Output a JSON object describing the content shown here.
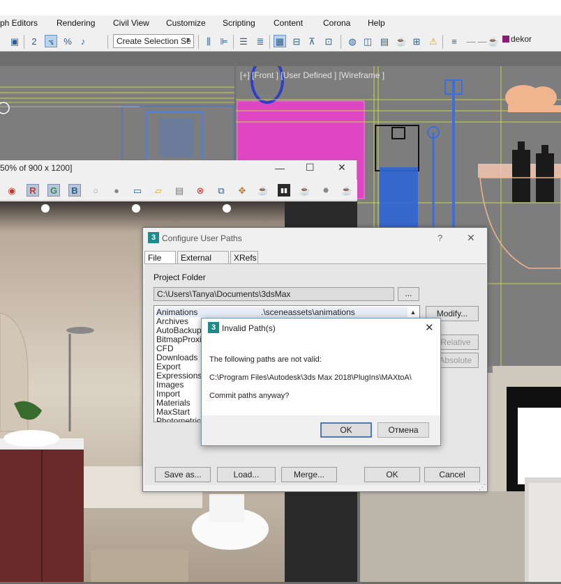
{
  "menubar": {
    "items": [
      "ph Editors",
      "Rendering",
      "Civil View",
      "Customize",
      "Scripting",
      "Content",
      "Corona",
      "Help"
    ]
  },
  "toolbar": {
    "selection_set": "Create Selection Se",
    "layer_name": "dekor"
  },
  "viewport_front": {
    "label": "[+] [Front ] [User Defined ] [Wireframe ]"
  },
  "frame_window": {
    "title": "50% of 900 x 1200]"
  },
  "config_dialog": {
    "title": "Configure User Paths",
    "help": "?",
    "close": "✕",
    "tabs": [
      "File I/O",
      "External Files",
      "XRefs"
    ],
    "project_folder_label": "Project Folder",
    "project_folder_value": "C:\\Users\\Tanya\\Documents\\3dsMax",
    "browse_label": "...",
    "paths": [
      {
        "name": "Animations",
        "value": ".\\sceneassets\\animations"
      },
      {
        "name": "Archives",
        "value": ""
      },
      {
        "name": "AutoBackup",
        "value": ""
      },
      {
        "name": "BitmapProxies",
        "value": ""
      },
      {
        "name": "CFD",
        "value": ""
      },
      {
        "name": "Downloads",
        "value": ""
      },
      {
        "name": "Export",
        "value": ""
      },
      {
        "name": "Expressions",
        "value": ""
      },
      {
        "name": "Images",
        "value": ""
      },
      {
        "name": "Import",
        "value": ""
      },
      {
        "name": "Materials",
        "value": ""
      },
      {
        "name": "MaxStart",
        "value": ""
      },
      {
        "name": "Photometric",
        "value": ""
      }
    ],
    "modify_label": "Modify...",
    "make_relative_label": "e Relative",
    "make_absolute_label": "e Absolute",
    "save_as_label": "Save as...",
    "load_label": "Load...",
    "merge_label": "Merge...",
    "ok_label": "OK",
    "cancel_label": "Cancel"
  },
  "invalid_dialog": {
    "title": "Invalid Path(s)",
    "close": "✕",
    "message": "The following paths are not valid:",
    "path": "C:\\Program Files\\Autodesk\\3ds Max 2018\\PlugIns\\MAXtoA\\",
    "question": "Commit paths anyway?",
    "ok_label": "OK",
    "cancel_label": "Отмена"
  },
  "colors": {
    "accent": "#4e7ab3",
    "app_icon": "#1f8a8a",
    "wireframe_pink": "#ee3ccd",
    "wireframe_blue": "#3a6fe0",
    "wireframe_yellow": "#c9d64a"
  }
}
